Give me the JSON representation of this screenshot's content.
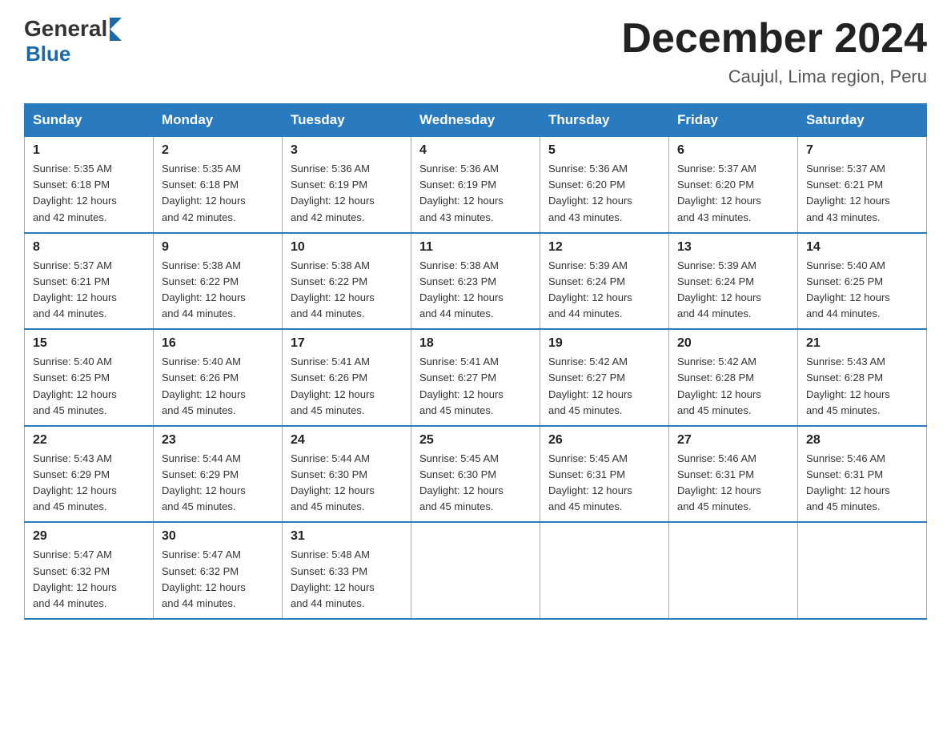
{
  "logo": {
    "general": "General",
    "arrow": "▶",
    "blue": "Blue"
  },
  "title": "December 2024",
  "subtitle": "Caujul, Lima region, Peru",
  "days_of_week": [
    "Sunday",
    "Monday",
    "Tuesday",
    "Wednesday",
    "Thursday",
    "Friday",
    "Saturday"
  ],
  "weeks": [
    [
      {
        "day": "1",
        "sunrise": "5:35 AM",
        "sunset": "6:18 PM",
        "daylight": "12 hours and 42 minutes."
      },
      {
        "day": "2",
        "sunrise": "5:35 AM",
        "sunset": "6:18 PM",
        "daylight": "12 hours and 42 minutes."
      },
      {
        "day": "3",
        "sunrise": "5:36 AM",
        "sunset": "6:19 PM",
        "daylight": "12 hours and 42 minutes."
      },
      {
        "day": "4",
        "sunrise": "5:36 AM",
        "sunset": "6:19 PM",
        "daylight": "12 hours and 43 minutes."
      },
      {
        "day": "5",
        "sunrise": "5:36 AM",
        "sunset": "6:20 PM",
        "daylight": "12 hours and 43 minutes."
      },
      {
        "day": "6",
        "sunrise": "5:37 AM",
        "sunset": "6:20 PM",
        "daylight": "12 hours and 43 minutes."
      },
      {
        "day": "7",
        "sunrise": "5:37 AM",
        "sunset": "6:21 PM",
        "daylight": "12 hours and 43 minutes."
      }
    ],
    [
      {
        "day": "8",
        "sunrise": "5:37 AM",
        "sunset": "6:21 PM",
        "daylight": "12 hours and 44 minutes."
      },
      {
        "day": "9",
        "sunrise": "5:38 AM",
        "sunset": "6:22 PM",
        "daylight": "12 hours and 44 minutes."
      },
      {
        "day": "10",
        "sunrise": "5:38 AM",
        "sunset": "6:22 PM",
        "daylight": "12 hours and 44 minutes."
      },
      {
        "day": "11",
        "sunrise": "5:38 AM",
        "sunset": "6:23 PM",
        "daylight": "12 hours and 44 minutes."
      },
      {
        "day": "12",
        "sunrise": "5:39 AM",
        "sunset": "6:24 PM",
        "daylight": "12 hours and 44 minutes."
      },
      {
        "day": "13",
        "sunrise": "5:39 AM",
        "sunset": "6:24 PM",
        "daylight": "12 hours and 44 minutes."
      },
      {
        "day": "14",
        "sunrise": "5:40 AM",
        "sunset": "6:25 PM",
        "daylight": "12 hours and 44 minutes."
      }
    ],
    [
      {
        "day": "15",
        "sunrise": "5:40 AM",
        "sunset": "6:25 PM",
        "daylight": "12 hours and 45 minutes."
      },
      {
        "day": "16",
        "sunrise": "5:40 AM",
        "sunset": "6:26 PM",
        "daylight": "12 hours and 45 minutes."
      },
      {
        "day": "17",
        "sunrise": "5:41 AM",
        "sunset": "6:26 PM",
        "daylight": "12 hours and 45 minutes."
      },
      {
        "day": "18",
        "sunrise": "5:41 AM",
        "sunset": "6:27 PM",
        "daylight": "12 hours and 45 minutes."
      },
      {
        "day": "19",
        "sunrise": "5:42 AM",
        "sunset": "6:27 PM",
        "daylight": "12 hours and 45 minutes."
      },
      {
        "day": "20",
        "sunrise": "5:42 AM",
        "sunset": "6:28 PM",
        "daylight": "12 hours and 45 minutes."
      },
      {
        "day": "21",
        "sunrise": "5:43 AM",
        "sunset": "6:28 PM",
        "daylight": "12 hours and 45 minutes."
      }
    ],
    [
      {
        "day": "22",
        "sunrise": "5:43 AM",
        "sunset": "6:29 PM",
        "daylight": "12 hours and 45 minutes."
      },
      {
        "day": "23",
        "sunrise": "5:44 AM",
        "sunset": "6:29 PM",
        "daylight": "12 hours and 45 minutes."
      },
      {
        "day": "24",
        "sunrise": "5:44 AM",
        "sunset": "6:30 PM",
        "daylight": "12 hours and 45 minutes."
      },
      {
        "day": "25",
        "sunrise": "5:45 AM",
        "sunset": "6:30 PM",
        "daylight": "12 hours and 45 minutes."
      },
      {
        "day": "26",
        "sunrise": "5:45 AM",
        "sunset": "6:31 PM",
        "daylight": "12 hours and 45 minutes."
      },
      {
        "day": "27",
        "sunrise": "5:46 AM",
        "sunset": "6:31 PM",
        "daylight": "12 hours and 45 minutes."
      },
      {
        "day": "28",
        "sunrise": "5:46 AM",
        "sunset": "6:31 PM",
        "daylight": "12 hours and 45 minutes."
      }
    ],
    [
      {
        "day": "29",
        "sunrise": "5:47 AM",
        "sunset": "6:32 PM",
        "daylight": "12 hours and 44 minutes."
      },
      {
        "day": "30",
        "sunrise": "5:47 AM",
        "sunset": "6:32 PM",
        "daylight": "12 hours and 44 minutes."
      },
      {
        "day": "31",
        "sunrise": "5:48 AM",
        "sunset": "6:33 PM",
        "daylight": "12 hours and 44 minutes."
      },
      null,
      null,
      null,
      null
    ]
  ],
  "labels": {
    "sunrise": "Sunrise:",
    "sunset": "Sunset:",
    "daylight": "Daylight:"
  }
}
